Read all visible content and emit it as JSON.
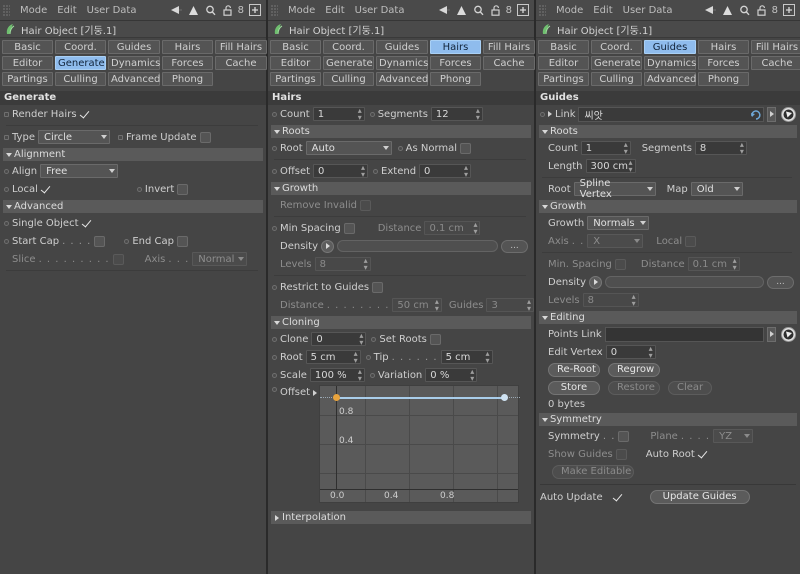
{
  "toolbar": {
    "menus": [
      "Mode",
      "Edit",
      "User Data"
    ],
    "icons": [
      "back-arrow-icon",
      "up-arrow-icon",
      "magnifier-icon",
      "lock-open-icon",
      "layer-count-icon",
      "expand-icon"
    ],
    "layer_count": "8"
  },
  "object": {
    "title": "Hair Object [기둥.1]",
    "icon": "hair-object-icon"
  },
  "tabs": {
    "row1": [
      "Basic",
      "Coord.",
      "Guides",
      "Hairs",
      "Fill Hairs"
    ],
    "row2": [
      "Editor",
      "Generate",
      "Dynamics",
      "Forces",
      "Cache"
    ],
    "row3": [
      "Partings",
      "Culling",
      "Advanced",
      "Phong"
    ]
  },
  "panel1": {
    "selected_tab": "Generate",
    "band": "Generate",
    "render_hairs": {
      "label": "Render Hairs",
      "checked": true
    },
    "type": {
      "label": "Type",
      "value": "Circle"
    },
    "frame_update": {
      "label": "Frame Update",
      "checked": false
    },
    "alignment": {
      "title": "Alignment",
      "align": {
        "label": "Align",
        "value": "Free"
      },
      "local": {
        "label": "Local",
        "checked": true
      },
      "invert": {
        "label": "Invert",
        "checked": false
      }
    },
    "advanced": {
      "title": "Advanced",
      "single_object": {
        "label": "Single Object",
        "checked": true
      },
      "start_cap": {
        "label": "Start Cap",
        "dots": ". . . .",
        "checked": false
      },
      "end_cap": {
        "label": "End Cap",
        "checked": false
      },
      "slice": {
        "label": "Slice",
        "dots": ". . . . . . . . .",
        "checked": false,
        "disabled": true
      },
      "axis": {
        "label": "Axis",
        "dots": ". . .",
        "value": "Normal",
        "disabled": true
      }
    }
  },
  "panel2": {
    "selected_tab": "Hairs",
    "band": "Hairs",
    "count": {
      "label": "Count",
      "value": "1"
    },
    "segments": {
      "label": "Segments",
      "value": "12"
    },
    "roots": {
      "title": "Roots",
      "root": {
        "label": "Root",
        "value": "Auto"
      },
      "as_normal": {
        "label": "As Normal",
        "checked": false
      },
      "offset": {
        "label": "Offset",
        "value": "0"
      },
      "extend": {
        "label": "Extend",
        "value": "0"
      }
    },
    "growth": {
      "title": "Growth",
      "remove_invalid": {
        "label": "Remove Invalid",
        "checked": false,
        "disabled": true
      },
      "min_spacing": {
        "label": "Min Spacing",
        "checked": false
      },
      "distance": {
        "label": "Distance",
        "value": "0.1 cm",
        "disabled": true
      },
      "density": {
        "label": "Density",
        "ellipsis": "..."
      },
      "levels": {
        "label": "Levels",
        "value": "8",
        "disabled": true
      },
      "restrict_to_guides": {
        "label": "Restrict to Guides",
        "checked": false
      },
      "restrict_distance": {
        "label": "Distance",
        "dots": ". . . . . . . .",
        "value": "50 cm",
        "disabled": true
      },
      "guides": {
        "label": "Guides",
        "value": "3",
        "disabled": true
      }
    },
    "cloning": {
      "title": "Cloning",
      "clone": {
        "label": "Clone",
        "value": "0"
      },
      "set_roots": {
        "label": "Set Roots",
        "checked": false
      },
      "root": {
        "label": "Root",
        "value": "5 cm"
      },
      "tip": {
        "label": "Tip",
        "dots": ". . . . . .",
        "value": "5 cm"
      },
      "scale": {
        "label": "Scale",
        "value": "100 %"
      },
      "variation": {
        "label": "Variation",
        "value": "0 %"
      },
      "offset": {
        "label": "Offset"
      }
    },
    "graph": {
      "x_ticks": [
        "0.0",
        "0.4",
        "0.8"
      ],
      "y_ticks": [
        "0.4",
        "0.8"
      ],
      "curve_value": 1.0
    },
    "interpolation": {
      "title": "Interpolation"
    }
  },
  "panel3": {
    "selected_tab": "Guides",
    "band": "Guides",
    "link": {
      "label": "Link",
      "value": "씨앗"
    },
    "roots": {
      "title": "Roots",
      "count": {
        "label": "Count",
        "value": "1"
      },
      "segments": {
        "label": "Segments",
        "value": "8"
      },
      "length": {
        "label": "Length",
        "value": "300 cm"
      },
      "root": {
        "label": "Root",
        "value": "Spline Vertex"
      },
      "map": {
        "label": "Map",
        "value": "Old"
      }
    },
    "growth": {
      "title": "Growth",
      "growth": {
        "label": "Growth",
        "value": "Normals"
      },
      "axis": {
        "label": "Axis",
        "dots": ". .",
        "value": "X",
        "disabled": true
      },
      "local": {
        "label": "Local",
        "checked": false,
        "disabled": true
      },
      "min_spacing": {
        "label": "Min. Spacing",
        "checked": false,
        "disabled": true
      },
      "distance": {
        "label": "Distance",
        "value": "0.1 cm",
        "disabled": true
      },
      "density": {
        "label": "Density",
        "ellipsis": "..."
      },
      "levels": {
        "label": "Levels",
        "value": "8",
        "disabled": true
      }
    },
    "editing": {
      "title": "Editing",
      "points_link": {
        "label": "Points Link",
        "value": ""
      },
      "edit_vertex": {
        "label": "Edit Vertex",
        "value": "0"
      },
      "re_root": "Re-Root",
      "regrow": "Regrow",
      "store": "Store",
      "restore": "Restore",
      "clear": "Clear",
      "bytes": "0 bytes"
    },
    "symmetry": {
      "title": "Symmetry",
      "symmetry": {
        "label": "Symmetry",
        "dots": ". .",
        "checked": false
      },
      "plane": {
        "label": "Plane",
        "dots": ". . . .",
        "value": "YZ",
        "disabled": true
      },
      "show_guides": {
        "label": "Show Guides",
        "checked": false,
        "disabled": true
      },
      "auto_root": {
        "label": "Auto Root",
        "checked": true
      },
      "make_editable": "Make Editable"
    },
    "auto_update": {
      "label": "Auto Update",
      "checked": true
    },
    "update_guides": "Update Guides"
  },
  "colors": {
    "panel_bg": "#454545",
    "band_bg": "#3b3b3b",
    "sub_bg": "#5a5a5a",
    "tab_selected": "#8fbced",
    "curve": "#a9cdea",
    "knot_start": "#e8a33d"
  }
}
